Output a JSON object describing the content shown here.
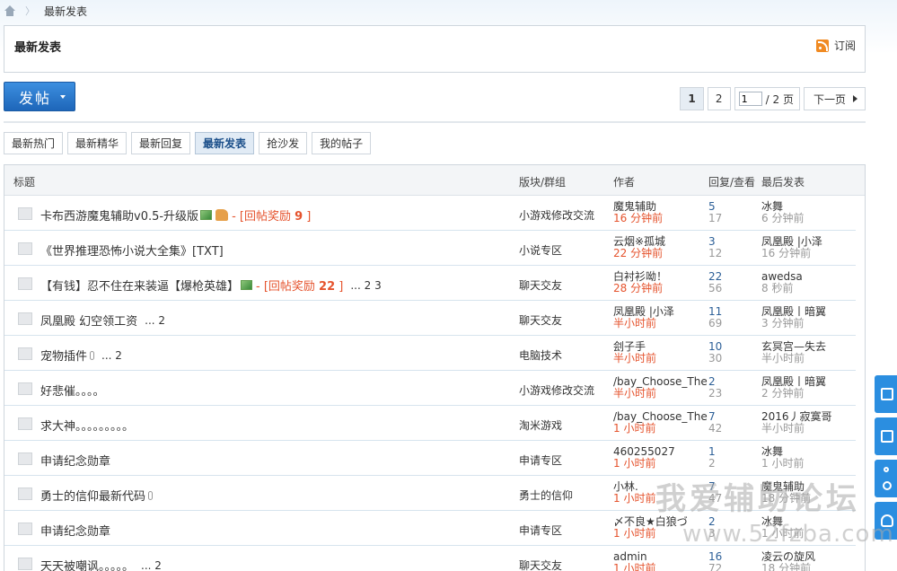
{
  "breadcrumb": {
    "current": "最新发表"
  },
  "header": {
    "title": "最新发表",
    "subscribe": "订阅"
  },
  "post_button": {
    "label": "发帖"
  },
  "pager": {
    "pages": [
      "1",
      "2"
    ],
    "jump_value": "1",
    "total": "/ 2 页",
    "next": "下一页"
  },
  "tabs": [
    "最新热门",
    "最新精华",
    "最新回复",
    "最新发表",
    "抢沙发",
    "我的帖子"
  ],
  "table": {
    "headers": {
      "title": "标题",
      "forum": "版块/群组",
      "author": "作者",
      "stats": "回复/查看",
      "last": "最后发表"
    },
    "rows": [
      {
        "title": "卡布西游魔鬼辅助v0.5-升级版",
        "suffix": "- [回帖奖励 ",
        "reward": "9",
        "reward_end": " ]",
        "more": "",
        "forum": "小游戏修改交流",
        "author": "魔鬼辅助",
        "author_time": "16 分钟前",
        "replies": "5",
        "views": "17",
        "last_author": "冰舞",
        "last_time": "6 分钟前"
      },
      {
        "title": "《世界推理恐怖小说大全集》[TXT]",
        "suffix": "",
        "reward": "",
        "reward_end": "",
        "more": "",
        "forum": "小说专区",
        "author": "云烟※孤城",
        "author_time": "22 分钟前",
        "replies": "3",
        "views": "12",
        "last_author": "凤凰殿 |小泽",
        "last_time": "16 分钟前"
      },
      {
        "title": "【有钱】忍不住在来装逼【爆枪英雄】",
        "suffix": "- [回帖奖励 ",
        "reward": "22",
        "reward_end": " ]",
        "more": "... 2  3",
        "forum": "聊天交友",
        "author": "白衬衫呦！",
        "author_time": "28 分钟前",
        "replies": "22",
        "views": "56",
        "last_author": "awedsa",
        "last_time": "8 秒前"
      },
      {
        "title": "凤凰殿 幻空领工资",
        "suffix": "",
        "reward": "",
        "reward_end": "",
        "more": "... 2",
        "forum": "聊天交友",
        "author": "凤凰殿 |小泽",
        "author_time": "半小时前",
        "replies": "11",
        "views": "69",
        "last_author": "凤凰殿丨暗翼",
        "last_time": "3 分钟前"
      },
      {
        "title": "宠物插件",
        "suffix": "",
        "reward": "",
        "reward_end": "",
        "more": "... 2",
        "forum": "电脑技术",
        "author": "刽子手",
        "author_time": "半小时前",
        "replies": "10",
        "views": "30",
        "last_author": "玄冥宫—失去",
        "last_time": "半小时前"
      },
      {
        "title": "好悲催。。。。",
        "suffix": "",
        "reward": "",
        "reward_end": "",
        "more": "",
        "forum": "小游戏修改交流",
        "author": "/bay_Choose_The",
        "author_time": "半小时前",
        "replies": "2",
        "views": "23",
        "last_author": "凤凰殿丨暗翼",
        "last_time": "2 分钟前"
      },
      {
        "title": "求大神。。。。。。。。。",
        "suffix": "",
        "reward": "",
        "reward_end": "",
        "more": "",
        "forum": "淘米游戏",
        "author": "/bay_Choose_The",
        "author_time": "1 小时前",
        "replies": "7",
        "views": "42",
        "last_author": "2016丿寂寞哥",
        "last_time": "半小时前"
      },
      {
        "title": "申请纪念勋章",
        "suffix": "",
        "reward": "",
        "reward_end": "",
        "more": "",
        "forum": "申请专区",
        "author": "460255027",
        "author_time": "1 小时前",
        "replies": "1",
        "views": "2",
        "last_author": "冰舞",
        "last_time": "1 小时前"
      },
      {
        "title": "勇士的信仰最新代码",
        "suffix": "",
        "reward": "",
        "reward_end": "",
        "more": "",
        "forum": "勇士的信仰",
        "author": "小林.",
        "author_time": "1 小时前",
        "replies": "7",
        "views": "47",
        "last_author": "魔鬼辅助",
        "last_time": "18 分钟前"
      },
      {
        "title": "申请纪念勋章",
        "suffix": "",
        "reward": "",
        "reward_end": "",
        "more": "",
        "forum": "申请专区",
        "author": "〆不良★白狼づ",
        "author_time": "1 小时前",
        "replies": "2",
        "views": "3",
        "last_author": "冰舞",
        "last_time": "1 小时前"
      },
      {
        "title": "天天被嘲讽。。。。。",
        "suffix": "",
        "reward": "",
        "reward_end": "",
        "more": "... 2",
        "forum": "聊天交友",
        "author": "admin",
        "author_time": "1 小时前",
        "replies": "16",
        "views": "72",
        "last_author": "凌云の旋风",
        "last_time": "18 分钟前"
      }
    ]
  },
  "watermark": {
    "line1": "我爱辅助论坛",
    "line2": "www.52fzba.com"
  }
}
